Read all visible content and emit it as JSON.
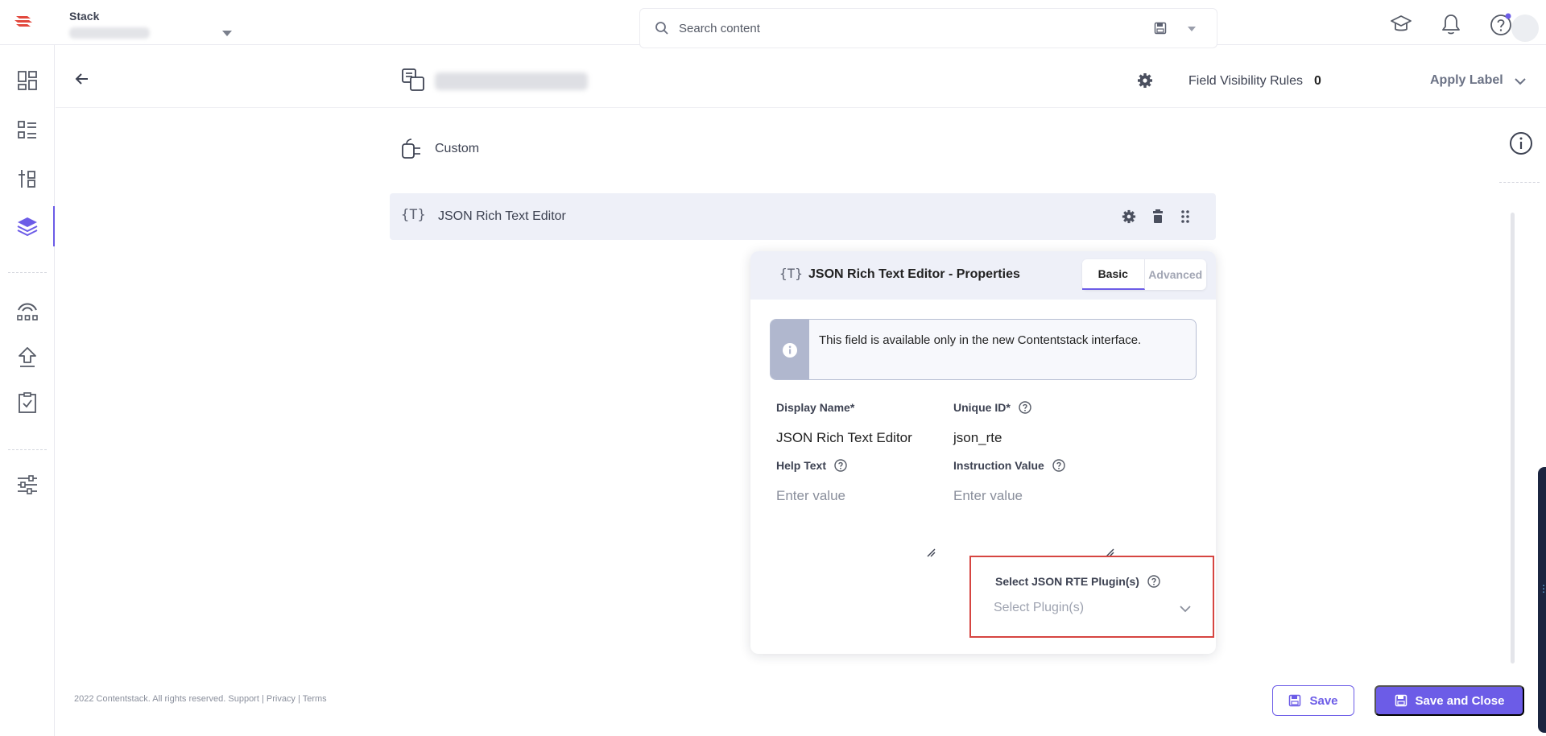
{
  "topbar": {
    "stack_label": "Stack",
    "search_placeholder": "Search content"
  },
  "header": {
    "field_visibility_label": "Field Visibility Rules",
    "field_visibility_count": "0",
    "apply_label": "Apply Label"
  },
  "fields": {
    "custom_label": "Custom",
    "json_rte_label": "JSON Rich Text Editor"
  },
  "properties": {
    "title": "JSON Rich Text Editor - Properties",
    "tab_basic": "Basic",
    "tab_advanced": "Advanced",
    "info_text": "This field is available only in the new Contentstack interface.",
    "display_name_label": "Display Name*",
    "display_name_value": "JSON Rich Text Editor",
    "unique_id_label": "Unique ID*",
    "unique_id_value": "json_rte",
    "help_text_label": "Help Text",
    "help_text_placeholder": "Enter value",
    "instruction_label": "Instruction Value",
    "instruction_placeholder": "Enter value",
    "plugin_label": "Select JSON RTE Plugin(s)",
    "plugin_placeholder": "Select Plugin(s)"
  },
  "footer": {
    "copyright": "2022 Contentstack. All rights reserved. Support | Privacy | Terms"
  },
  "actions": {
    "save": "Save",
    "save_and_close": "Save and Close"
  },
  "colors": {
    "accent": "#6c5ce7",
    "highlight_border": "#d64541",
    "brand": "#e2483d"
  }
}
